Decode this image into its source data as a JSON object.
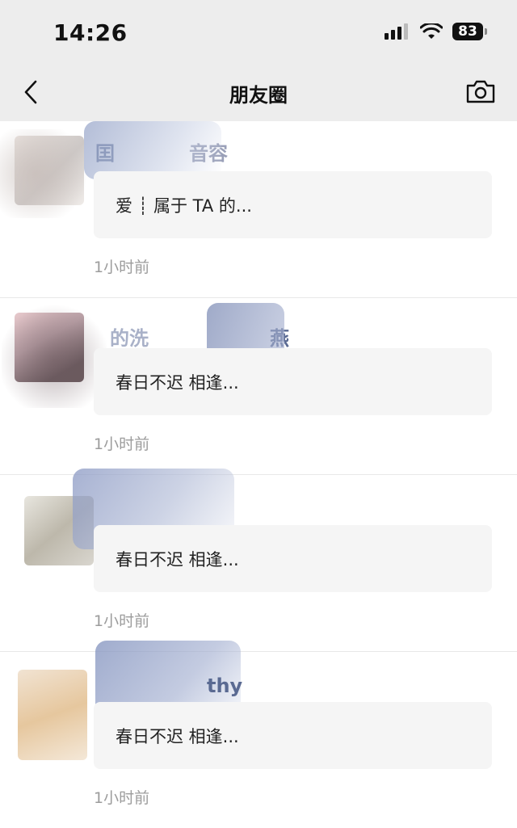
{
  "status_bar": {
    "time": "14:26",
    "battery": "83",
    "icons": [
      "signal-icon",
      "wifi-icon",
      "battery-icon"
    ]
  },
  "nav": {
    "title": "朋友圈",
    "back_icon": "chevron-left-icon",
    "camera_icon": "camera-icon"
  },
  "items": [
    {
      "name": "囯",
      "name_suffix": "音容",
      "preview": "爱 ┊ 属于 TA 的...",
      "time": "1小时前"
    },
    {
      "name": "的洗",
      "name_suffix": "燕",
      "preview": "春日不迟 相逢...",
      "time": "1小时前"
    },
    {
      "name": "",
      "name_suffix": "",
      "preview": "春日不迟 相逢...",
      "time": "1小时前"
    },
    {
      "name": "",
      "name_suffix": "thy",
      "preview": "春日不迟 相逢...",
      "time": "1小时前"
    }
  ],
  "colors": {
    "header_bg": "#ededed",
    "card_bg": "#f5f5f5",
    "name_color": "#5a6a92",
    "timestamp_color": "#9c9c9c"
  }
}
